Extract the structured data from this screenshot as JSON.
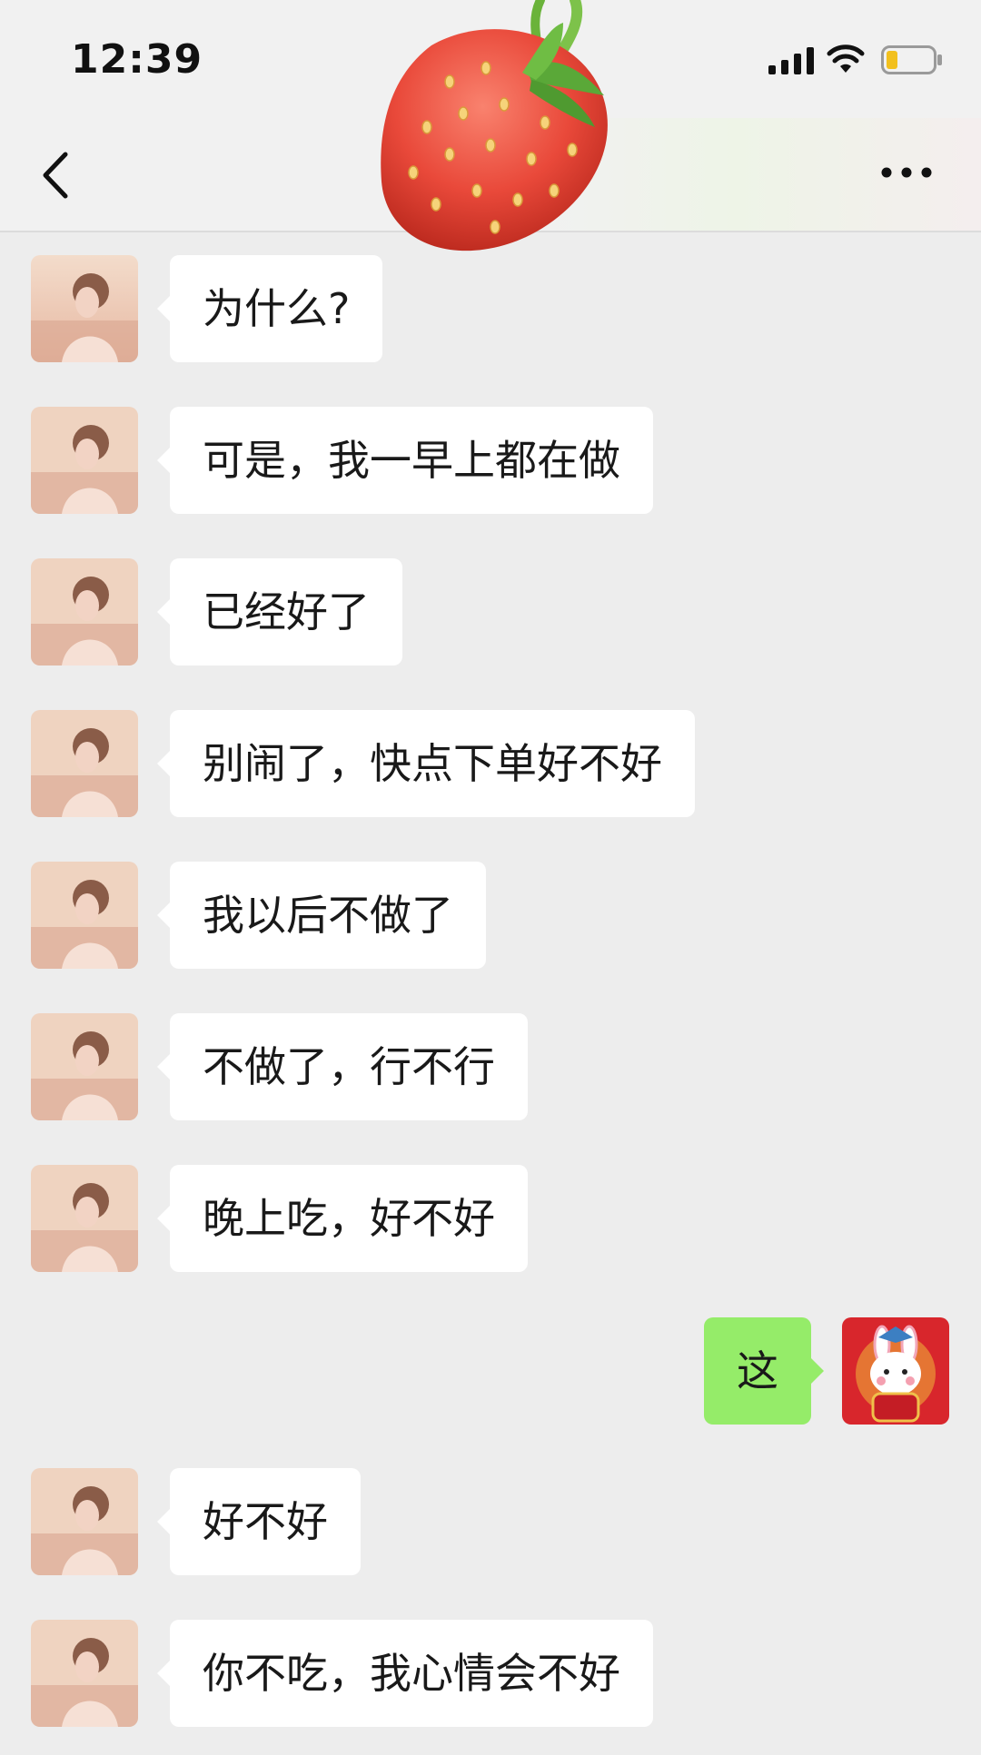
{
  "status_bar": {
    "time": "12:39"
  },
  "nav": {
    "back_icon": "chevron-left-icon",
    "more_icon": "more-dots-icon"
  },
  "sticker": {
    "icon": "strawberry-sticker"
  },
  "colors": {
    "background": "#ededed",
    "incoming_bubble": "#ffffff",
    "outgoing_bubble": "#95ec69",
    "text": "#191919"
  },
  "messages": [
    {
      "side": "left",
      "text": "为什么?"
    },
    {
      "side": "left",
      "text": "可是，我一早上都在做"
    },
    {
      "side": "left",
      "text": "已经好了"
    },
    {
      "side": "left",
      "text": "别闹了，快点下单好不好"
    },
    {
      "side": "left",
      "text": "我以后不做了"
    },
    {
      "side": "left",
      "text": "不做了，行不行"
    },
    {
      "side": "left",
      "text": "晚上吃，好不好"
    },
    {
      "side": "right",
      "text": "这"
    },
    {
      "side": "left",
      "text": "好不好"
    },
    {
      "side": "left",
      "text": "你不吃，我心情会不好"
    }
  ]
}
